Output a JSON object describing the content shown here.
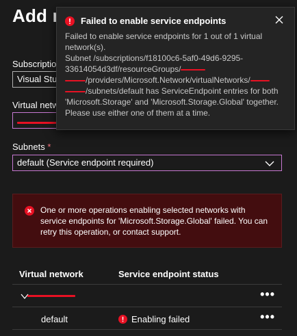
{
  "panel": {
    "title": "Add n"
  },
  "form": {
    "subscription_label": "Subscription",
    "subscription_value": "Visual Stu",
    "virtual_network_label": "Virtual netw",
    "subnets_label": "Subnets",
    "required_mark": "*",
    "subnets_value": "default (Service endpoint required)"
  },
  "error_banner": {
    "message": "One or more operations enabling selected networks with service endpoints for 'Microsoft.Storage.Global' failed. You can retry this operation, or contact support."
  },
  "table": {
    "col_virtual_network": "Virtual network",
    "col_status": "Service endpoint status",
    "more_label": "•••",
    "rows": [
      {
        "name": "",
        "status": ""
      },
      {
        "name": "default",
        "status": "Enabling failed"
      }
    ]
  },
  "toast": {
    "title": "Failed to enable service endpoints",
    "body_part1": "Failed to enable service endpoints for 1 out of 1 virtual network(s).",
    "body_part2": "Subnet /subscriptions/f18100c6-5af0-49d6-9295-33614054d3df/resourceGroups/",
    "body_part3": "/providers/Microsoft.Network/virtualNetworks/",
    "body_part4": "/subnets/default has ServiceEndpoint entries for both 'Microsoft.Storage' and 'Microsoft.Storage.Global' together. Please use either one of them at a time."
  },
  "colors": {
    "accent_focus": "#c879d3",
    "error_red": "#e81123",
    "banner_bg": "#430d0f"
  },
  "icons": {
    "error": "error-circle-icon",
    "close": "close-icon",
    "chevron": "chevron-down-icon",
    "more": "more-dots-icon"
  }
}
